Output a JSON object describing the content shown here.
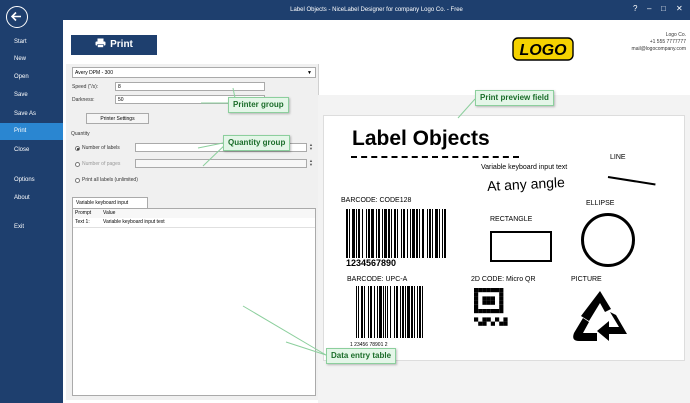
{
  "window": {
    "title": "Label Objects - NiceLabel Designer for company Logo Co. - Free",
    "controls": [
      "?",
      "–",
      "□",
      "✕"
    ]
  },
  "sidebar": {
    "back_icon": "arrow-left-icon",
    "items": [
      {
        "label": "Start"
      },
      {
        "label": "New"
      },
      {
        "label": "Open"
      },
      {
        "label": "Save"
      },
      {
        "label": "Save As"
      },
      {
        "label": "Print",
        "active": true
      },
      {
        "label": "Close"
      },
      {
        "label": "Options"
      },
      {
        "label": "About"
      },
      {
        "label": "Exit"
      }
    ]
  },
  "toolbar": {
    "print_label": "Print",
    "print_icon": "printer-icon"
  },
  "company": {
    "logo_text": "LOGO",
    "name": "Logo Co.",
    "phone": "+1 555 7777777",
    "email": "mail@logocompany.com"
  },
  "printer": {
    "selected": "Avery DPM - 300",
    "speed_label": "Speed (\"/s):",
    "speed_value": "8",
    "darkness_label": "Darkness:",
    "darkness_value": "50",
    "settings_button": "Printer Settings"
  },
  "quantity": {
    "group_label": "Quantity",
    "options": [
      "Number of labels",
      "Number of pages",
      "Print all labels (unlimited)"
    ],
    "selected_index": 0
  },
  "data_table": {
    "tab_label": "Variable keyboard input",
    "columns": [
      "Prompt",
      "Value"
    ],
    "rows": [
      [
        "Text 1:",
        "Variable keyboard input text"
      ]
    ]
  },
  "preview": {
    "title": "Label Objects",
    "variable_text": "Variable keyboard input text",
    "angle_text": "At any angle",
    "line_label": "LINE",
    "barcode_label": "BARCODE: CODE128",
    "barcode_value": "1234567890",
    "rectangle_label": "RECTANGLE",
    "ellipse_label": "ELLIPSE",
    "upc_label": "BARCODE: UPC-A",
    "upc_value": "1   23456   78901   2",
    "qr_label": "2D CODE: Micro QR",
    "picture_label": "PICTURE",
    "recycle_icon": "recycle-icon"
  },
  "callouts": {
    "printer_group": "Printer group",
    "quantity_group": "Quantity group",
    "print_preview": "Print preview field",
    "data_entry": "Data entry table"
  },
  "colors": {
    "sidebar": "#1e3f6e",
    "active": "#2a86d1",
    "callout_bg": "#e4f6e8",
    "callout_text": "#1b6d2a"
  }
}
